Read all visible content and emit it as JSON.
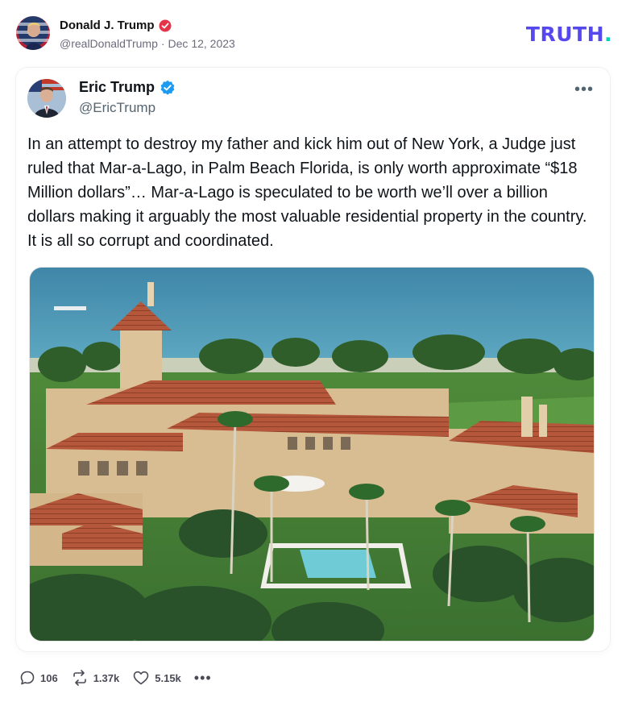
{
  "post": {
    "author_name": "Donald J. Trump",
    "handle": "@realDonaldTrump",
    "separator": "·",
    "date": "Dec 12, 2023",
    "logo_text": "TRUTH",
    "logo_dot": ".",
    "verified_icon": "verified-badge-red-icon"
  },
  "embedded_post": {
    "author_name": "Eric Trump",
    "handle": "@EricTrump",
    "verified_icon": "verified-badge-blue-icon",
    "more_label": "•••",
    "text": "In an attempt to destroy my father and kick him out of New York, a Judge just ruled that Mar-a-Lago, in Palm Beach Florida, is only worth approximate “$18 Million dollars”… Mar-a-Lago is speculated to be worth we’ll over a billion dollars making it arguably the most valuable residential property in the country. It is all so corrupt and coordinated.",
    "image_description_icon": "aerial-photo-mar-a-lago"
  },
  "actions": {
    "replies": "106",
    "retruths": "1.37k",
    "likes": "5.15k",
    "more_label": "•••"
  },
  "colors": {
    "brand": "#5448ee",
    "brand_dot": "#00d2bb",
    "verified_red": "#e5334a",
    "verified_blue": "#1d9bf0",
    "muted": "#6b6b7b"
  }
}
